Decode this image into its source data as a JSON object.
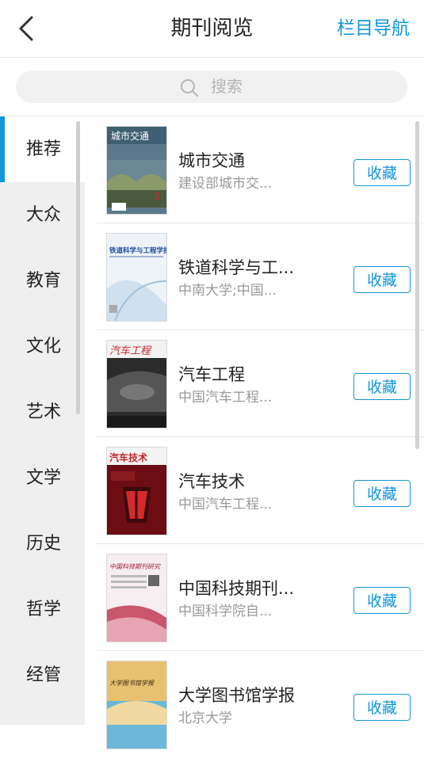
{
  "header": {
    "title": "期刊阅览",
    "nav_label": "栏目导航"
  },
  "search": {
    "placeholder": "搜索"
  },
  "sidebar": {
    "items": [
      "推荐",
      "大众",
      "教育",
      "文化",
      "艺术",
      "文学",
      "历史",
      "哲学",
      "经管"
    ],
    "active_index": 0
  },
  "journals": [
    {
      "name": "城市交通",
      "publisher": "建设部城市交...",
      "button": "收藏",
      "cover": {
        "title": "城市交通",
        "bg": "#5a7a8c",
        "accent": "#d8dfe4",
        "issue": "5"
      }
    },
    {
      "name": "铁道科学与工...",
      "publisher": "中南大学;中国...",
      "button": "收藏",
      "cover": {
        "title": "铁道科学与工程学报",
        "bg": "#eef3f8",
        "accent": "#1e4f9c"
      }
    },
    {
      "name": "汽车工程",
      "publisher": "中国汽车工程...",
      "button": "收藏",
      "cover": {
        "title": "汽车工程",
        "bg": "#2b2b2b",
        "accent": "#c8242a"
      }
    },
    {
      "name": "汽车技术",
      "publisher": "中国汽车工程...",
      "button": "收藏",
      "cover": {
        "title": "汽车技术",
        "bg": "#6b0d12",
        "accent": "#d62a2a"
      }
    },
    {
      "name": "中国科技期刊...",
      "publisher": "中国科学院自...",
      "button": "收藏",
      "cover": {
        "title": "中国科技期刊研究",
        "bg": "#f6eef0",
        "accent": "#a0233a"
      }
    },
    {
      "name": "大学图书馆学报",
      "publisher": "北京大学",
      "button": "收藏",
      "cover": {
        "title": "大学图书馆学报",
        "bg": "#e8c170",
        "accent": "#4aa0c8"
      }
    }
  ],
  "colors": {
    "accent": "#1296db",
    "sidebar_bg": "#efefef"
  },
  "icons": {
    "back": "chevron-left-icon",
    "search": "search-icon"
  }
}
